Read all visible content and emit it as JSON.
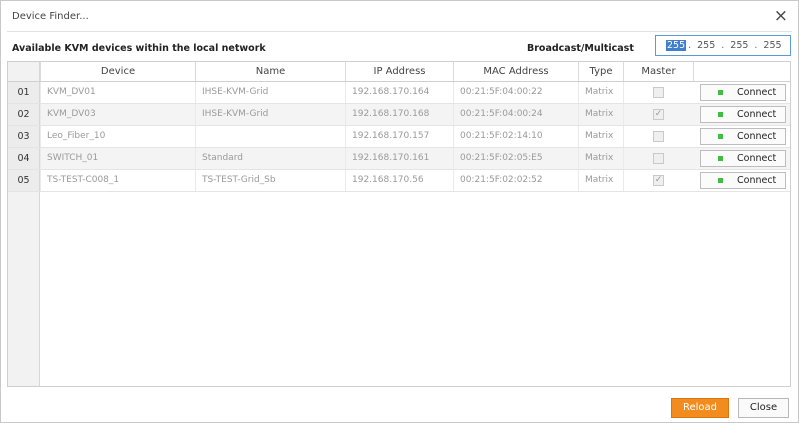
{
  "window": {
    "title": "Device Finder...",
    "close_glyph": "×"
  },
  "heading": "Available KVM devices within the local network",
  "broadcast": {
    "label": "Broadcast/Multicast",
    "octets": [
      "255",
      "255",
      "255",
      "255"
    ]
  },
  "table": {
    "columns": [
      "Device",
      "Name",
      "IP Address",
      "MAC Address",
      "Type",
      "Master"
    ],
    "rows": [
      {
        "num": "01",
        "device": "KVM_DV01",
        "name": "IHSE-KVM-Grid",
        "ip": "192.168.170.164",
        "mac": "00:21:5F:04:00:22",
        "type": "Matrix",
        "master": false,
        "action": "Connect"
      },
      {
        "num": "02",
        "device": "KVM_DV03",
        "name": "IHSE-KVM-Grid",
        "ip": "192.168.170.168",
        "mac": "00:21:5F:04:00:24",
        "type": "Matrix",
        "master": true,
        "action": "Connect"
      },
      {
        "num": "03",
        "device": "Leo_Fiber_10",
        "name": "",
        "ip": "192.168.170.157",
        "mac": "00:21:5F:02:14:10",
        "type": "Matrix",
        "master": false,
        "action": "Connect"
      },
      {
        "num": "04",
        "device": "SWITCH_01",
        "name": "Standard",
        "ip": "192.168.170.161",
        "mac": "00:21:5F:02:05:E5",
        "type": "Matrix",
        "master": false,
        "action": "Connect"
      },
      {
        "num": "05",
        "device": "TS-TEST-C008_1",
        "name": "TS-TEST-Grid_Sb",
        "ip": "192.168.170.56",
        "mac": "00:21:5F:02:02:52",
        "type": "Matrix",
        "master": true,
        "action": "Connect"
      }
    ]
  },
  "buttons": {
    "reload": "Reload",
    "close": "Close"
  },
  "colors": {
    "accent": "#f28c1f",
    "selection": "#3f7fcf",
    "status_led": "#3fbf3f"
  }
}
